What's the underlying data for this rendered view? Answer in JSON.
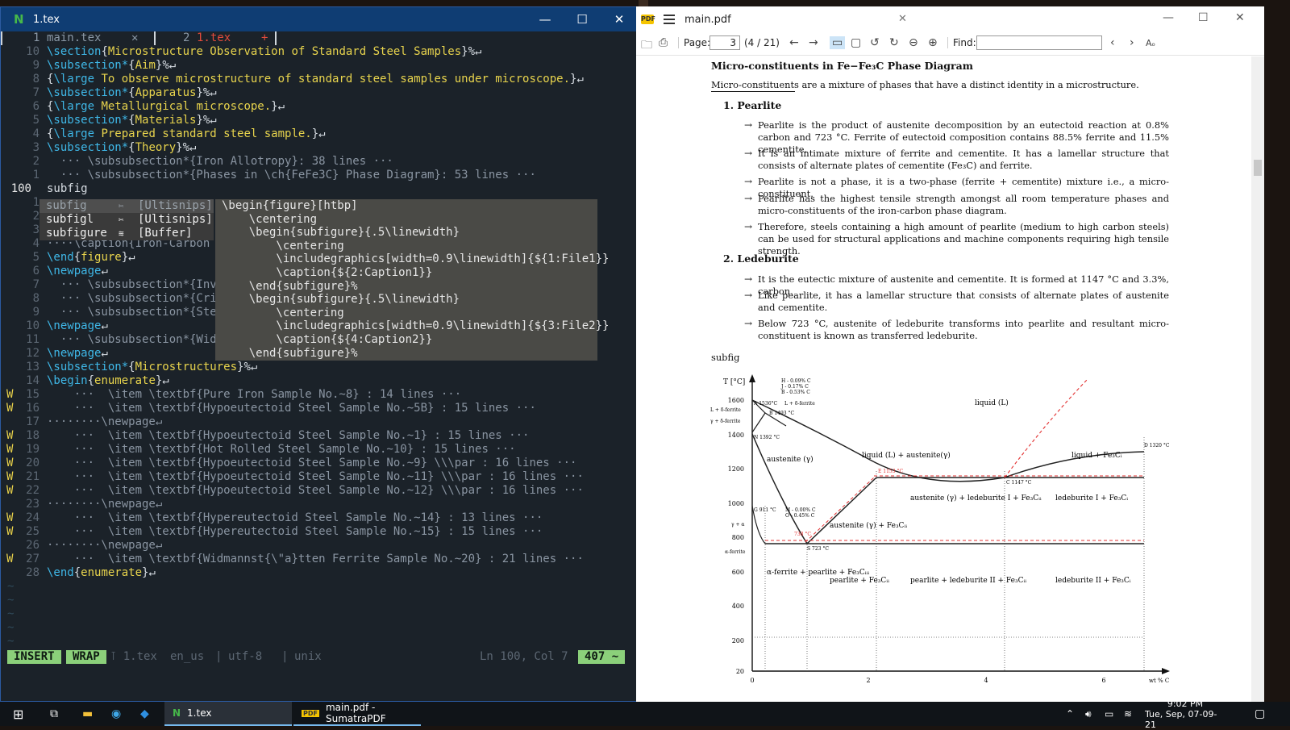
{
  "nvim": {
    "window_title": "1.tex",
    "tabs": [
      {
        "num": "1",
        "name": "main.tex",
        "marker": "✕"
      },
      {
        "num": "2",
        "name": "1.tex",
        "marker": "+"
      }
    ],
    "lines": [
      {
        "sign": "",
        "num": "10",
        "text": "\\section{Microstructure Observation of Standard Steel Samples}%↵"
      },
      {
        "sign": "",
        "num": "9",
        "text": "\\subsection*{Aim}%↵"
      },
      {
        "sign": "",
        "num": "8",
        "text": "{\\large To observe microstructure of standard steel samples under microscope.}↵"
      },
      {
        "sign": "",
        "num": "7",
        "text": "\\subsection*{Apparatus}%↵"
      },
      {
        "sign": "",
        "num": "6",
        "text": "{\\large Metallurgical microscope.}↵"
      },
      {
        "sign": "",
        "num": "5",
        "text": "\\subsection*{Materials}%↵"
      },
      {
        "sign": "",
        "num": "4",
        "text": "{\\large Prepared standard steel sample.}↵"
      },
      {
        "sign": "",
        "num": "3",
        "text": "\\subsection*{Theory}%↵"
      },
      {
        "sign": "",
        "num": "2",
        "text": "  ··· \\subsubsection*{Iron Allotropy}: 38 lines ···"
      },
      {
        "sign": "",
        "num": "1",
        "text": "  ··· \\subsubsection*{Phases in \\ch{FeFe3C} Phase Diagram}: 53 lines ···"
      },
      {
        "sign": "",
        "num": "100",
        "text": "subfig"
      },
      {
        "sign": "",
        "num": "1",
        "text": ""
      },
      {
        "sign": "",
        "num": "2",
        "text": ""
      },
      {
        "sign": "",
        "num": "3",
        "text": ""
      },
      {
        "sign": "",
        "num": "4",
        "text": "····\\caption{Iron-Carbon P"
      },
      {
        "sign": "",
        "num": "5",
        "text": "\\end{figure}↵"
      },
      {
        "sign": "",
        "num": "6",
        "text": "\\newpage↵"
      },
      {
        "sign": "",
        "num": "7",
        "text": "  ··· \\subsubsection*{Invar"
      },
      {
        "sign": "",
        "num": "8",
        "text": "  ··· \\subsubsection*{Criti"
      },
      {
        "sign": "",
        "num": "9",
        "text": "  ··· \\subsubsection*{Stee"
      },
      {
        "sign": "",
        "num": "10",
        "text": "\\newpage↵"
      },
      {
        "sign": "",
        "num": "11",
        "text": "  ··· \\subsubsection*{Widma"
      },
      {
        "sign": "",
        "num": "12",
        "text": "\\newpage↵"
      },
      {
        "sign": "",
        "num": "13",
        "text": "\\subsection*{Microstructures}%↵"
      },
      {
        "sign": "",
        "num": "14",
        "text": "\\begin{enumerate}↵"
      },
      {
        "sign": "W",
        "num": "15",
        "text": "    ···  \\item \\textbf{Pure Iron Sample No.~8} : 14 lines ···"
      },
      {
        "sign": "W",
        "num": "16",
        "text": "    ···  \\item \\textbf{Hypoeutectoid Steel Sample No.~5B} : 15 lines ···"
      },
      {
        "sign": "",
        "num": "17",
        "text": "········\\newpage↵"
      },
      {
        "sign": "W",
        "num": "18",
        "text": "    ···  \\item \\textbf{Hypoeutectoid Steel Sample No.~1} : 15 lines ···"
      },
      {
        "sign": "W",
        "num": "19",
        "text": "    ···  \\item \\textbf{Hot Rolled Steel Sample No.~10} : 15 lines ···"
      },
      {
        "sign": "W",
        "num": "20",
        "text": "    ···  \\item \\textbf{Hypoeutectoid Steel Sample No.~9} \\\\\\par : 16 lines ···"
      },
      {
        "sign": "W",
        "num": "21",
        "text": "    ···  \\item \\textbf{Hypoeutectoid Steel Sample No.~11} \\\\\\par : 16 lines ···"
      },
      {
        "sign": "W",
        "num": "22",
        "text": "    ···  \\item \\textbf{Hypoeutectoid Steel Sample No.~12} \\\\\\par : 16 lines ···"
      },
      {
        "sign": "",
        "num": "23",
        "text": "········\\newpage↵"
      },
      {
        "sign": "W",
        "num": "24",
        "text": "    ···  \\item \\textbf{Hypereutectoid Steel Sample No.~14} : 13 lines ···"
      },
      {
        "sign": "W",
        "num": "25",
        "text": "    ···  \\item \\textbf{Hypereutectoid Steel Sample No.~15} : 15 lines ···"
      },
      {
        "sign": "",
        "num": "26",
        "text": "········\\newpage↵"
      },
      {
        "sign": "W",
        "num": "27",
        "text": "    ···  \\item \\textbf{Widmannst{\\\"a}tten Ferrite Sample No.~20} : 21 lines ···"
      },
      {
        "sign": "",
        "num": "28",
        "text": "\\end{enumerate}↵"
      }
    ],
    "completion": [
      {
        "word": "subfig",
        "kind": "[Ultisnips]",
        "icon": "✂"
      },
      {
        "word": "subfigl",
        "kind": "[Ultisnips]",
        "icon": "✂"
      },
      {
        "word": "subfigure",
        "kind": "[Buffer]",
        "icon": "≋"
      }
    ],
    "preview": [
      "\\begin{figure}[htbp]",
      "    \\centering",
      "    \\begin{subfigure}{.5\\linewidth}",
      "        \\centering",
      "        \\includegraphics[width=0.9\\linewidth]{${1:File1}}",
      "        \\caption{${2:Caption1}}",
      "    \\end{subfigure}%",
      "    \\begin{subfigure}{.5\\linewidth}",
      "        \\centering",
      "        \\includegraphics[width=0.9\\linewidth]{${3:File2}}",
      "        \\caption{${4:Caption2}}",
      "    \\end{subfigure}%"
    ],
    "status": {
      "mode": "INSERT",
      "wrap": "WRAP",
      "file": "⊺ 1.tex",
      "spell": "en_us",
      "encoding": "utf-8",
      "format": "unix",
      "position": "Ln 100, Col 7",
      "words": "407 ~"
    }
  },
  "sumatra": {
    "tab_title": "main.pdf",
    "page_label": "Page:",
    "page_value": "3",
    "page_count": "(4 / 21)",
    "find_label": "Find:",
    "aa_label": "Aₒ",
    "heading": "Micro-constituents in Fe−Fe₃C Phase Diagram",
    "intro": "Micro-constituents are a mixture of phases that have a distinct identity in a microstructure.",
    "section1": "1. Pearlite",
    "pearlite_bullets": [
      "Pearlite is the product of austenite decomposition by an eutectoid reaction at 0.8% carbon and 723 °C. Ferrite of eutectoid composition contains 88.5% ferrite and 11.5% cementite.",
      "It is an intimate mixture of ferrite and cementite. It has a lamellar structure that consists of alternate plates of cementite (Fe₃C) and ferrite.",
      "Pearlite is not a phase, it is a two-phase (ferrite + cementite) mixture i.e., a micro-constituent.",
      "Pearlite has the highest tensile strength amongst all room temperature phases and micro-constituents of the iron-carbon phase diagram.",
      "Therefore, steels containing a high amount of pearlite (medium to high carbon steels) can be used for structural applications and machine components requiring high tensile strength."
    ],
    "section2": "2. Ledeburite",
    "ledeburite_bullets": [
      "It is the eutectic mixture of austenite and cementite. It is formed at 1147 °C and 3.3%, carbon.",
      "Like pearlite, it has a lamellar structure that consists of alternate plates of austenite and cementite.",
      "Below 723 °C, austenite of ledeburite transforms into pearlite and resultant micro-constituent is known as transferred ledeburite."
    ],
    "subfig_text": "subfig",
    "diagram": {
      "y_axis_label": "T [°C]",
      "y_ticks": [
        "1600",
        "1400",
        "1200",
        "1000",
        "800",
        "600",
        "400",
        "200",
        "20"
      ],
      "x_ticks": [
        "0",
        "2",
        "4",
        "6"
      ],
      "x_axis_label": "wt % C",
      "regions": [
        "liquid (L)",
        "austenite (γ)",
        "liquid (L) + austenite(γ)",
        "liquid + Fe₃Cᵢ",
        "austenite (γ) + ledeburite I + Fe₃Cᵢᵢ",
        "ledeburite I + Fe₃Cᵢ",
        "austenite (γ) + Fe₃Cᵢᵢ",
        "α-ferrite + pearlite + Fe₃Cᵢᵢᵢ",
        "pearlite + Fe₃Cᵢᵢ",
        "pearlite + ledeburite II + Fe₃Cᵢᵢ",
        "ledeburite II + Fe₃Cᵢ",
        "L + δ-ferrite",
        "γ + δ-ferrite",
        "γ + α",
        "α-ferrite"
      ],
      "points": [
        "H - 0.09% C",
        "J - 0.17% C",
        "B - 0.53% C",
        "A 1536°C",
        "B 1493 °C",
        "N 1392 °C",
        "E 1153 °C",
        "C 1147 °C",
        "D 1320 °C",
        "G 911 °C",
        "M - 0.00% C",
        "O - 0.45% C",
        "738 °C",
        "S 723 °C",
        "L + δ-ferrite"
      ]
    }
  },
  "taskbar": {
    "task1": "1.tex",
    "task2": "main.pdf - SumatraPDF",
    "time": "9:02 PM",
    "date": "Tue, Sep, 07-09-21"
  },
  "colors": {
    "editor_bg": "#1b2229",
    "mode_green": "#8bd07a",
    "keyword_blue": "#3fb8e8",
    "titlebar_blue": "#0f3d73"
  }
}
